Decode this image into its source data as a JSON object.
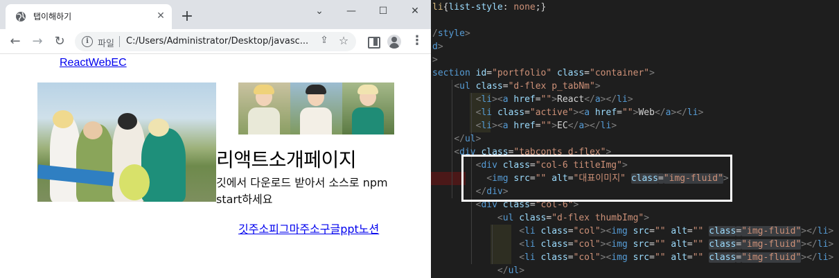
{
  "browser": {
    "tab_title": "탭이해하기",
    "tab_close": "✕",
    "new_tab": "+",
    "window_controls": {
      "dropdown": "⌄",
      "minimize": "—",
      "maximize": "☐",
      "close": "✕"
    },
    "nav": {
      "back": "←",
      "forward": "→",
      "reload": "↻"
    },
    "address": {
      "scheme_label": "파일",
      "url": "C:/Users/Administrator/Desktop/javasc...",
      "info": "i",
      "share": "⇪",
      "star": "☆"
    },
    "menu": "⋮"
  },
  "page": {
    "tab_nav_text": "ReactWebEC",
    "title": "리액트소개페이지",
    "description": "깃에서 다운로드 받아서 소스로 npm start하세요",
    "links_text": "깃주소피그마주소구글ppt노션"
  },
  "editor": {
    "lines": [
      [
        [
          "t-sel",
          "li"
        ],
        [
          "t-txt",
          "{"
        ],
        [
          "t-prop",
          "list-style"
        ],
        [
          "t-txt",
          ": "
        ],
        [
          "t-val",
          "none"
        ],
        [
          "t-txt",
          ";}"
        ]
      ],
      [],
      [
        [
          "t-pun",
          "/"
        ],
        [
          "t-tag",
          "style"
        ],
        [
          "t-pun",
          ">"
        ]
      ],
      [
        [
          "t-tag",
          "d"
        ],
        [
          "t-pun",
          ">"
        ]
      ],
      [
        [
          "t-pun",
          ">"
        ]
      ],
      [
        [
          "t-tag",
          "section "
        ],
        [
          "t-attr",
          "id"
        ],
        [
          "t-txt",
          "="
        ],
        [
          "t-str",
          "\"portfolio\""
        ],
        [
          "t-txt",
          " "
        ],
        [
          "t-attr",
          "class"
        ],
        [
          "t-txt",
          "="
        ],
        [
          "t-str",
          "\"container\""
        ],
        [
          "t-pun",
          ">"
        ]
      ],
      [
        [
          "t-txt",
          "    "
        ],
        [
          "t-pun",
          "<"
        ],
        [
          "t-tag",
          "ul "
        ],
        [
          "t-attr",
          "class"
        ],
        [
          "t-txt",
          "="
        ],
        [
          "t-str",
          "\"d-flex p_tabNm\""
        ],
        [
          "t-pun",
          ">"
        ]
      ],
      [
        [
          "t-txt",
          "        "
        ],
        [
          "t-pun",
          "<"
        ],
        [
          "t-tag",
          "li"
        ],
        [
          "t-pun",
          "><"
        ],
        [
          "t-tag",
          "a "
        ],
        [
          "t-attr",
          "href"
        ],
        [
          "t-txt",
          "="
        ],
        [
          "t-str",
          "\"\""
        ],
        [
          "t-pun",
          ">"
        ],
        [
          "t-txt",
          "React"
        ],
        [
          "t-pun",
          "</"
        ],
        [
          "t-tag",
          "a"
        ],
        [
          "t-pun",
          "></"
        ],
        [
          "t-tag",
          "li"
        ],
        [
          "t-pun",
          ">"
        ]
      ],
      [
        [
          "t-txt",
          "        "
        ],
        [
          "t-pun",
          "<"
        ],
        [
          "t-tag",
          "li "
        ],
        [
          "t-attr",
          "class"
        ],
        [
          "t-txt",
          "="
        ],
        [
          "t-str",
          "\"active\""
        ],
        [
          "t-pun",
          "><"
        ],
        [
          "t-tag",
          "a "
        ],
        [
          "t-attr",
          "href"
        ],
        [
          "t-txt",
          "="
        ],
        [
          "t-str",
          "\"\""
        ],
        [
          "t-pun",
          ">"
        ],
        [
          "t-txt",
          "Web"
        ],
        [
          "t-pun",
          "</"
        ],
        [
          "t-tag",
          "a"
        ],
        [
          "t-pun",
          "></"
        ],
        [
          "t-tag",
          "li"
        ],
        [
          "t-pun",
          ">"
        ]
      ],
      [
        [
          "t-txt",
          "        "
        ],
        [
          "t-pun",
          "<"
        ],
        [
          "t-tag",
          "li"
        ],
        [
          "t-pun",
          "><"
        ],
        [
          "t-tag",
          "a "
        ],
        [
          "t-attr",
          "href"
        ],
        [
          "t-txt",
          "="
        ],
        [
          "t-str",
          "\"\""
        ],
        [
          "t-pun",
          ">"
        ],
        [
          "t-txt",
          "EC"
        ],
        [
          "t-pun",
          "</"
        ],
        [
          "t-tag",
          "a"
        ],
        [
          "t-pun",
          "></"
        ],
        [
          "t-tag",
          "li"
        ],
        [
          "t-pun",
          ">"
        ]
      ],
      [
        [
          "t-txt",
          "    "
        ],
        [
          "t-pun",
          "</"
        ],
        [
          "t-tag",
          "ul"
        ],
        [
          "t-pun",
          ">"
        ]
      ],
      [
        [
          "t-txt",
          "    "
        ],
        [
          "t-pun",
          "<"
        ],
        [
          "t-tag",
          "div "
        ],
        [
          "t-attr",
          "class"
        ],
        [
          "t-txt",
          "="
        ],
        [
          "t-str",
          "\"tabconts d-flex\""
        ],
        [
          "t-pun",
          ">"
        ]
      ],
      [
        [
          "t-txt",
          "        "
        ],
        [
          "t-pun",
          "<"
        ],
        [
          "t-tag",
          "div "
        ],
        [
          "t-attr",
          "class"
        ],
        [
          "t-txt",
          "="
        ],
        [
          "t-str",
          "\"col-6 titleImg\""
        ],
        [
          "t-pun",
          ">"
        ]
      ],
      [
        [
          "t-txt",
          "          "
        ],
        [
          "t-pun",
          "<"
        ],
        [
          "t-tag",
          "img "
        ],
        [
          "t-attr",
          "src"
        ],
        [
          "t-txt",
          "="
        ],
        [
          "t-str",
          "\"\""
        ],
        [
          "t-txt",
          " "
        ],
        [
          "t-attr",
          "alt"
        ],
        [
          "t-txt",
          "="
        ],
        [
          "t-str",
          "\"대표이미지\""
        ],
        [
          "t-txt",
          " "
        ],
        [
          "t-attr hl-word",
          "class"
        ],
        [
          "t-txt hl-word",
          "="
        ],
        [
          "t-str hl-word",
          "\"img-fluid\""
        ],
        [
          "t-pun",
          ">"
        ]
      ],
      [
        [
          "t-txt",
          "        "
        ],
        [
          "t-pun",
          "</"
        ],
        [
          "t-tag",
          "div"
        ],
        [
          "t-pun",
          ">"
        ]
      ],
      [
        [
          "t-txt",
          "        "
        ],
        [
          "t-pun",
          "<"
        ],
        [
          "t-tag",
          "div "
        ],
        [
          "t-attr",
          "class"
        ],
        [
          "t-txt",
          "="
        ],
        [
          "t-str",
          "\"col-6\""
        ],
        [
          "t-pun",
          ">"
        ]
      ],
      [
        [
          "t-txt",
          "            "
        ],
        [
          "t-pun",
          "<"
        ],
        [
          "t-tag",
          "ul "
        ],
        [
          "t-attr",
          "class"
        ],
        [
          "t-txt",
          "="
        ],
        [
          "t-str",
          "\"d-flex thumbImg\""
        ],
        [
          "t-pun",
          ">"
        ]
      ],
      [
        [
          "t-txt",
          "                "
        ],
        [
          "t-pun",
          "<"
        ],
        [
          "t-tag",
          "li "
        ],
        [
          "t-attr",
          "class"
        ],
        [
          "t-txt",
          "="
        ],
        [
          "t-str",
          "\"col\""
        ],
        [
          "t-pun",
          "><"
        ],
        [
          "t-tag",
          "img "
        ],
        [
          "t-attr",
          "src"
        ],
        [
          "t-txt",
          "="
        ],
        [
          "t-str",
          "\"\""
        ],
        [
          "t-txt",
          " "
        ],
        [
          "t-attr",
          "alt"
        ],
        [
          "t-txt",
          "="
        ],
        [
          "t-str",
          "\"\""
        ],
        [
          "t-txt",
          " "
        ],
        [
          "t-attr hl-word",
          "class"
        ],
        [
          "t-txt hl-word",
          "="
        ],
        [
          "t-str hl-word",
          "\"img-fluid\""
        ],
        [
          "t-pun",
          "></"
        ],
        [
          "t-tag",
          "li"
        ],
        [
          "t-pun",
          ">"
        ]
      ],
      [
        [
          "t-txt",
          "                "
        ],
        [
          "t-pun",
          "<"
        ],
        [
          "t-tag",
          "li "
        ],
        [
          "t-attr",
          "class"
        ],
        [
          "t-txt",
          "="
        ],
        [
          "t-str",
          "\"col\""
        ],
        [
          "t-pun",
          "><"
        ],
        [
          "t-tag",
          "img "
        ],
        [
          "t-attr",
          "src"
        ],
        [
          "t-txt",
          "="
        ],
        [
          "t-str",
          "\"\""
        ],
        [
          "t-txt",
          " "
        ],
        [
          "t-attr",
          "alt"
        ],
        [
          "t-txt",
          "="
        ],
        [
          "t-str",
          "\"\""
        ],
        [
          "t-txt",
          " "
        ],
        [
          "t-attr hl-word",
          "class"
        ],
        [
          "t-txt hl-word",
          "="
        ],
        [
          "t-str hl-word",
          "\"img-fluid\""
        ],
        [
          "t-pun",
          "></"
        ],
        [
          "t-tag",
          "li"
        ],
        [
          "t-pun",
          ">"
        ]
      ],
      [
        [
          "t-txt",
          "                "
        ],
        [
          "t-pun",
          "<"
        ],
        [
          "t-tag",
          "li "
        ],
        [
          "t-attr",
          "class"
        ],
        [
          "t-txt",
          "="
        ],
        [
          "t-str",
          "\"col\""
        ],
        [
          "t-pun",
          "><"
        ],
        [
          "t-tag",
          "img "
        ],
        [
          "t-attr",
          "src"
        ],
        [
          "t-txt",
          "="
        ],
        [
          "t-str",
          "\"\""
        ],
        [
          "t-txt",
          " "
        ],
        [
          "t-attr",
          "alt"
        ],
        [
          "t-txt",
          "="
        ],
        [
          "t-str",
          "\"\""
        ],
        [
          "t-txt",
          " "
        ],
        [
          "t-attr hl-word",
          "class"
        ],
        [
          "t-txt hl-word",
          "="
        ],
        [
          "t-str hl-word",
          "\"img-fluid\""
        ],
        [
          "t-pun",
          "></"
        ],
        [
          "t-tag",
          "li"
        ],
        [
          "t-pun",
          ">"
        ]
      ],
      [
        [
          "t-txt",
          "            "
        ],
        [
          "t-pun",
          "</"
        ],
        [
          "t-tag",
          "ul"
        ],
        [
          "t-pun",
          ">"
        ]
      ]
    ]
  },
  "colors": {
    "browser_chrome": "#dee1e6",
    "link": "#0000ee",
    "editor_bg": "#1e1e1e",
    "tag": "#569cd6",
    "attr": "#9cdcfe",
    "string": "#ce9178",
    "highlight_box": "#ffffff"
  }
}
